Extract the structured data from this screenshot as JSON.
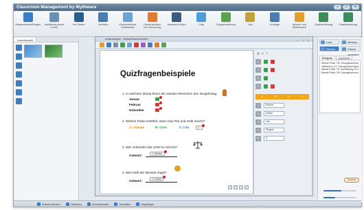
{
  "app": {
    "title": "Classroom Management by Mythware"
  },
  "window_controls": [
    "–",
    "□",
    "×"
  ],
  "ribbon": {
    "buttons": [
      {
        "icon": "classroom-model-icon",
        "label": "Klassenmodel/Rugeln",
        "color": "#3a7fc4"
      },
      {
        "icon": "students-attention-icon",
        "label": "Aufklärung durch Lehrer",
        "color": "#6b8fb3"
      },
      {
        "icon": "monitor-icon",
        "label": "Ver-Sehen",
        "color": "#2c5f8f"
      },
      {
        "icon": "share-icon",
        "label": "Verteilen",
        "color": "#4a7db0"
      },
      {
        "icon": "whiteboard-icon",
        "label": "Elektronisches Whiteboard",
        "color": "#6fa4d2"
      },
      {
        "icon": "teacher-icon",
        "label": "Demonstration und Steuerung",
        "color": "#e07b32"
      },
      {
        "icon": "video-icon",
        "label": "Netzwerk-Video",
        "color": "#3b5c7e"
      },
      {
        "icon": "chat-icon",
        "label": "Chat",
        "color": "#4b9ed8"
      },
      {
        "icon": "group-icon",
        "label": "Gruppensetzung",
        "color": "#5ba14e"
      },
      {
        "icon": "text-icon",
        "label": "Text",
        "color": "#c4a13a"
      },
      {
        "icon": "survey-icon",
        "label": "Umfrage",
        "color": "#4a7db0"
      },
      {
        "icon": "contest-icon",
        "label": "Antwort und Wettbewerb",
        "color": "#e0a030"
      },
      {
        "icon": "transfer-icon",
        "label": "Dateiverteilung",
        "color": "#3e8e5c"
      },
      {
        "icon": "collect-icon",
        "label": "Dateisammlung",
        "color": "#3e8e5c"
      }
    ]
  },
  "left_panel": {
    "tab": "Ansichtswahl"
  },
  "document": {
    "window_title": "Antwortbogen · Antwortblatteinstellen",
    "title": "Quizfragenbeispiele",
    "questions": [
      {
        "text": "1. In welchem Monat feiern die meisten Menschen den Neujahrstag"
      },
      {
        "text": "2. Welche Farbe entsteht, wenn man Rot und Gelb mischt?"
      },
      {
        "text": "3. Wer verkündet das Urteil im Gericht?"
      },
      {
        "text": "4. Wie heißt der kleinste Vogel?"
      }
    ],
    "q1_answers": [
      "Januar",
      "Februar",
      "Dezember"
    ],
    "q2_options": [
      {
        "text": "A: Orange",
        "color": "#e08a10"
      },
      {
        "text": "B: Grün",
        "color": "#3aa34a"
      },
      {
        "text": "C: Lila",
        "color": "#2f6fc0"
      }
    ],
    "answer_label": "Antwort:",
    "answer_field": "1: Richter",
    "answer_field_4": "1: Kolibri",
    "q2_box": "1"
  },
  "state_panel": {
    "tabs": [
      "A",
      "B",
      "C",
      "D"
    ],
    "rows": [
      {
        "num": "1",
        "value": "Richter"
      },
      {
        "num": "2",
        "value": "Kolibri"
      },
      {
        "num": "3",
        "value": "Lila"
      },
      {
        "num": "4",
        "value": "Pinguin"
      },
      {
        "num": "5",
        "value": "Z"
      }
    ]
  },
  "right_panel": {
    "buttons": [
      {
        "label": "Liste",
        "selected": false
      },
      {
        "label": "Miniatur",
        "selected": false
      },
      {
        "label": "Kleines Bild",
        "selected": true
      },
      {
        "label": "Klasse verwalten",
        "selected": false
      }
    ],
    "tabs": [
      "Ereignis",
      "Nachricht"
    ],
    "log": [
      "Mwxst.Ph8xr TN: Ubungstuchmodus 25.0.10",
      "Tabellorez_67: Ubungstuchmodus 28.03.2022",
      "Mwxst.Ph8xr TN: Anmeldung 29.0.10",
      "Mwxst.Ph8xr TN: Übungstuchmodus 29.07.10"
    ],
    "speaker_button": "Sprech",
    "volume": 0.55,
    "mic": 0.35
  },
  "statusbar": {
    "items": [
      "Anschl.sperren",
      "Gefolaen",
      "Informationen",
      "Senfallen",
      "Ungültigen"
    ]
  }
}
